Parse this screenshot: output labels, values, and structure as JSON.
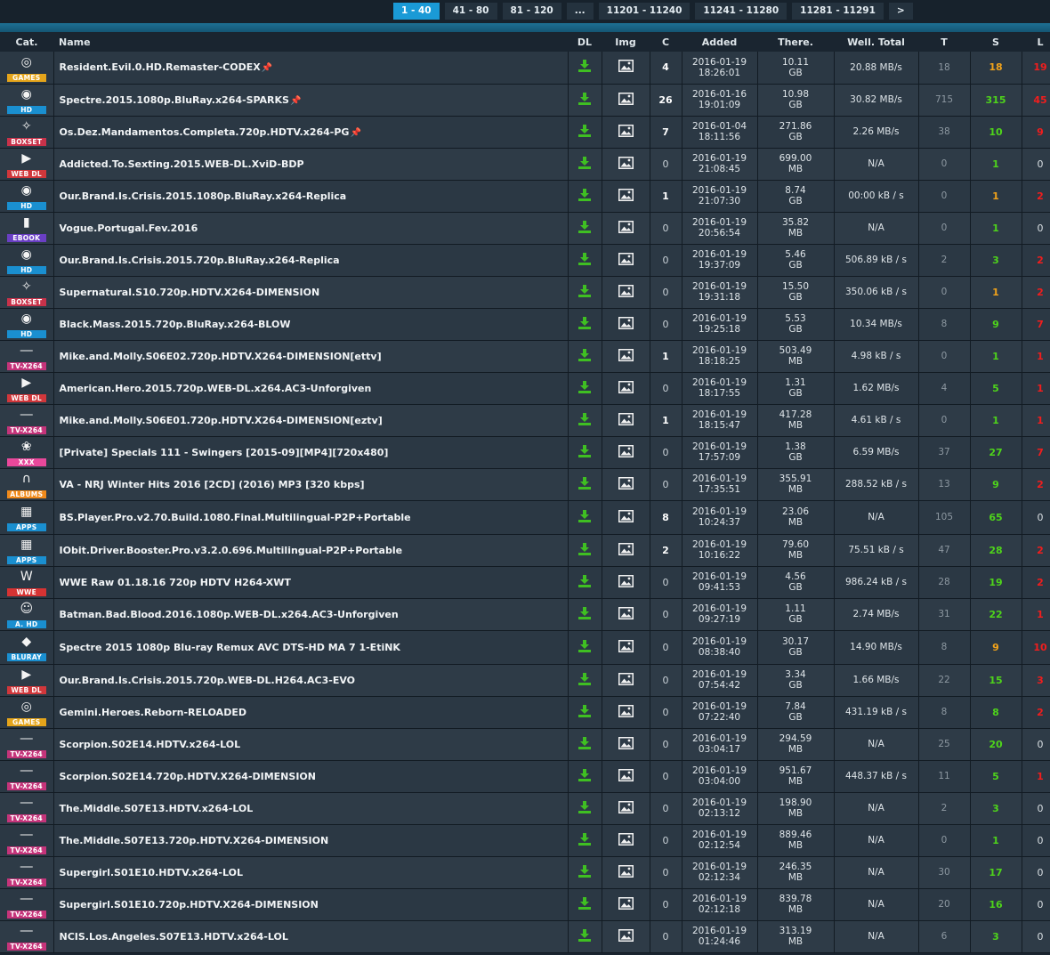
{
  "pagination": {
    "pages": [
      "1 - 40",
      "41 - 80",
      "81 - 120",
      "...",
      "11201 - 11240",
      "11241 - 11280",
      "11281 - 11291",
      ">"
    ],
    "active": 0
  },
  "headers": {
    "cat": "Cat.",
    "name": "Name",
    "dl": "DL",
    "img": "Img",
    "c": "C",
    "added": "Added",
    "size": "There.",
    "speed": "Well. Total",
    "t": "T",
    "s": "S",
    "l": "L"
  },
  "categories": {
    "GAMES": {
      "color": "#e5a51b",
      "icon": "disc-icon",
      "glyph": "◎"
    },
    "HD": {
      "color": "#1a8fd0",
      "icon": "disc-icon",
      "glyph": "◉"
    },
    "BOXSET": {
      "color": "#c8324a",
      "icon": "box-icon",
      "glyph": "✧"
    },
    "WEB DL": {
      "color": "#d1373b",
      "icon": "play-icon",
      "glyph": "▶"
    },
    "EBOOK": {
      "color": "#6a3fc4",
      "icon": "book-icon",
      "glyph": "▮"
    },
    "TV-X264": {
      "color": "#c5347a",
      "icon": "tv-icon",
      "glyph": "―"
    },
    "XXX": {
      "color": "#e9489b",
      "icon": "bunny-icon",
      "glyph": "❀"
    },
    "ALBUMS": {
      "color": "#f08a1b",
      "icon": "headphones-icon",
      "glyph": "∩"
    },
    "APPS": {
      "color": "#1a8fd0",
      "icon": "windows-icon",
      "glyph": "▦"
    },
    "WWE": {
      "color": "#d63333",
      "icon": "wwe-icon",
      "glyph": "W"
    },
    "A. HD": {
      "color": "#1a8fd0",
      "icon": "cartoon-icon",
      "glyph": "☺"
    },
    "BLURAY": {
      "color": "#1a8fd0",
      "icon": "bluray-icon",
      "glyph": "◆"
    }
  },
  "rows": [
    {
      "cat": "GAMES",
      "name": "Resident.Evil.0.HD.Remaster-CODEX",
      "pinned": true,
      "c": "4",
      "added": [
        "2016-01-19",
        "18:26:01"
      ],
      "size": [
        "10.11",
        "GB"
      ],
      "speed": "20.88 MB/s",
      "t": "18",
      "s": "18",
      "l": "19",
      "s_orange": true
    },
    {
      "cat": "HD",
      "name": "Spectre.2015.1080p.BluRay.x264-SPARKS",
      "pinned": true,
      "c": "26",
      "added": [
        "2016-01-16",
        "19:01:09"
      ],
      "size": [
        "10.98",
        "GB"
      ],
      "speed": "30.82 MB/s",
      "t": "715",
      "s": "315",
      "l": "45"
    },
    {
      "cat": "BOXSET",
      "name": "Os.Dez.Mandamentos.Completa.720p.HDTV.x264-PG",
      "pinned": true,
      "c": "7",
      "added": [
        "2016-01-04",
        "18:11:56"
      ],
      "size": [
        "271.86",
        "GB"
      ],
      "speed": "2.26 MB/s",
      "t": "38",
      "s": "10",
      "l": "9"
    },
    {
      "cat": "WEB DL",
      "name": "Addicted.To.Sexting.2015.WEB-DL.XviD-BDP",
      "pinned": false,
      "c": "0",
      "added": [
        "2016-01-19",
        "21:08:45"
      ],
      "size": [
        "699.00",
        "MB"
      ],
      "speed": "N/A",
      "t": "0",
      "s": "1",
      "l": "0"
    },
    {
      "cat": "HD",
      "name": "Our.Brand.Is.Crisis.2015.1080p.BluRay.x264-Replica",
      "pinned": false,
      "c": "1",
      "added": [
        "2016-01-19",
        "21:07:30"
      ],
      "size": [
        "8.74",
        "GB"
      ],
      "speed": "00:00 kB / s",
      "t": "0",
      "s": "1",
      "l": "2",
      "s_orange": true
    },
    {
      "cat": "EBOOK",
      "name": "Vogue.Portugal.Fev.2016",
      "pinned": false,
      "c": "0",
      "added": [
        "2016-01-19",
        "20:56:54"
      ],
      "size": [
        "35.82",
        "MB"
      ],
      "speed": "N/A",
      "t": "0",
      "s": "1",
      "l": "0"
    },
    {
      "cat": "HD",
      "name": "Our.Brand.Is.Crisis.2015.720p.BluRay.x264-Replica",
      "pinned": false,
      "c": "0",
      "added": [
        "2016-01-19",
        "19:37:09"
      ],
      "size": [
        "5.46",
        "GB"
      ],
      "speed": "506.89 kB / s",
      "t": "2",
      "s": "3",
      "l": "2"
    },
    {
      "cat": "BOXSET",
      "name": "Supernatural.S10.720p.HDTV.X264-DIMENSION",
      "pinned": false,
      "c": "0",
      "added": [
        "2016-01-19",
        "19:31:18"
      ],
      "size": [
        "15.50",
        "GB"
      ],
      "speed": "350.06 kB / s",
      "t": "0",
      "s": "1",
      "l": "2",
      "s_orange": true
    },
    {
      "cat": "HD",
      "name": "Black.Mass.2015.720p.BluRay.x264-BLOW",
      "pinned": false,
      "c": "0",
      "added": [
        "2016-01-19",
        "19:25:18"
      ],
      "size": [
        "5.53",
        "GB"
      ],
      "speed": "10.34 MB/s",
      "t": "8",
      "s": "9",
      "l": "7"
    },
    {
      "cat": "TV-X264",
      "name": "Mike.and.Molly.S06E02.720p.HDTV.X264-DIMENSION[ettv]",
      "pinned": false,
      "c": "1",
      "added": [
        "2016-01-19",
        "18:18:25"
      ],
      "size": [
        "503.49",
        "MB"
      ],
      "speed": "4.98 kB / s",
      "t": "0",
      "s": "1",
      "l": "1"
    },
    {
      "cat": "WEB DL",
      "name": "American.Hero.2015.720p.WEB-DL.x264.AC3-Unforgiven",
      "pinned": false,
      "c": "0",
      "added": [
        "2016-01-19",
        "18:17:55"
      ],
      "size": [
        "1.31",
        "GB"
      ],
      "speed": "1.62 MB/s",
      "t": "4",
      "s": "5",
      "l": "1"
    },
    {
      "cat": "TV-X264",
      "name": "Mike.and.Molly.S06E01.720p.HDTV.X264-DIMENSION[eztv]",
      "pinned": false,
      "c": "1",
      "added": [
        "2016-01-19",
        "18:15:47"
      ],
      "size": [
        "417.28",
        "MB"
      ],
      "speed": "4.61 kB / s",
      "t": "0",
      "s": "1",
      "l": "1"
    },
    {
      "cat": "XXX",
      "name": "[Private] Specials 111 - Swingers [2015-09][MP4][720x480]",
      "pinned": false,
      "c": "0",
      "added": [
        "2016-01-19",
        "17:57:09"
      ],
      "size": [
        "1.38",
        "GB"
      ],
      "speed": "6.59 MB/s",
      "t": "37",
      "s": "27",
      "l": "7"
    },
    {
      "cat": "ALBUMS",
      "name": "VA - NRJ Winter Hits 2016 [2CD] (2016) MP3 [320 kbps]",
      "pinned": false,
      "c": "0",
      "added": [
        "2016-01-19",
        "17:35:51"
      ],
      "size": [
        "355.91",
        "MB"
      ],
      "speed": "288.52 kB / s",
      "t": "13",
      "s": "9",
      "l": "2"
    },
    {
      "cat": "APPS",
      "name": "BS.Player.Pro.v2.70.Build.1080.Final.Multilingual-P2P+Portable",
      "pinned": false,
      "c": "8",
      "added": [
        "2016-01-19",
        "10:24:37"
      ],
      "size": [
        "23.06",
        "MB"
      ],
      "speed": "N/A",
      "t": "105",
      "s": "65",
      "l": "0",
      "tall": true
    },
    {
      "cat": "APPS",
      "name": "IObit.Driver.Booster.Pro.v3.2.0.696.Multilingual-P2P+Portable",
      "pinned": false,
      "c": "2",
      "added": [
        "2016-01-19",
        "10:16:22"
      ],
      "size": [
        "79.60",
        "MB"
      ],
      "speed": "75.51 kB / s",
      "t": "47",
      "s": "28",
      "l": "2"
    },
    {
      "cat": "WWE",
      "name": "WWE Raw 01.18.16 720p HDTV H264-XWT",
      "pinned": false,
      "c": "0",
      "added": [
        "2016-01-19",
        "09:41:53"
      ],
      "size": [
        "4.56",
        "GB"
      ],
      "speed": "986.24 kB / s",
      "t": "28",
      "s": "19",
      "l": "2"
    },
    {
      "cat": "A. HD",
      "name": "Batman.Bad.Blood.2016.1080p.WEB-DL.x264.AC3-Unforgiven",
      "pinned": false,
      "c": "0",
      "added": [
        "2016-01-19",
        "09:27:19"
      ],
      "size": [
        "1.11",
        "GB"
      ],
      "speed": "2.74 MB/s",
      "t": "31",
      "s": "22",
      "l": "1"
    },
    {
      "cat": "BLURAY",
      "name": "Spectre 2015 1080p Blu-ray Remux AVC DTS-HD MA 7 1-EtiNK",
      "pinned": false,
      "c": "0",
      "added": [
        "2016-01-19",
        "08:38:40"
      ],
      "size": [
        "30.17",
        "GB"
      ],
      "speed": "14.90 MB/s",
      "t": "8",
      "s": "9",
      "l": "10",
      "s_orange": true,
      "tall": true
    },
    {
      "cat": "WEB DL",
      "name": "Our.Brand.Is.Crisis.2015.720p.WEB-DL.H264.AC3-EVO",
      "pinned": false,
      "c": "0",
      "added": [
        "2016-01-19",
        "07:54:42"
      ],
      "size": [
        "3.34",
        "GB"
      ],
      "speed": "1.66 MB/s",
      "t": "22",
      "s": "15",
      "l": "3"
    },
    {
      "cat": "GAMES",
      "name": "Gemini.Heroes.Reborn-RELOADED",
      "pinned": false,
      "c": "0",
      "added": [
        "2016-01-19",
        "07:22:40"
      ],
      "size": [
        "7.84",
        "GB"
      ],
      "speed": "431.19 kB / s",
      "t": "8",
      "s": "8",
      "l": "2"
    },
    {
      "cat": "TV-X264",
      "name": "Scorpion.S02E14.HDTV.x264-LOL",
      "pinned": false,
      "c": "0",
      "added": [
        "2016-01-19",
        "03:04:17"
      ],
      "size": [
        "294.59",
        "MB"
      ],
      "speed": "N/A",
      "t": "25",
      "s": "20",
      "l": "0"
    },
    {
      "cat": "TV-X264",
      "name": "Scorpion.S02E14.720p.HDTV.X264-DIMENSION",
      "pinned": false,
      "c": "0",
      "added": [
        "2016-01-19",
        "03:04:00"
      ],
      "size": [
        "951.67",
        "MB"
      ],
      "speed": "448.37 kB / s",
      "t": "11",
      "s": "5",
      "l": "1"
    },
    {
      "cat": "TV-X264",
      "name": "The.Middle.S07E13.HDTV.x264-LOL",
      "pinned": false,
      "c": "0",
      "added": [
        "2016-01-19",
        "02:13:12"
      ],
      "size": [
        "198.90",
        "MB"
      ],
      "speed": "N/A",
      "t": "2",
      "s": "3",
      "l": "0"
    },
    {
      "cat": "TV-X264",
      "name": "The.Middle.S07E13.720p.HDTV.X264-DIMENSION",
      "pinned": false,
      "c": "0",
      "added": [
        "2016-01-19",
        "02:12:54"
      ],
      "size": [
        "889.46",
        "MB"
      ],
      "speed": "N/A",
      "t": "0",
      "s": "1",
      "l": "0"
    },
    {
      "cat": "TV-X264",
      "name": "Supergirl.S01E10.HDTV.x264-LOL",
      "pinned": false,
      "c": "0",
      "added": [
        "2016-01-19",
        "02:12:34"
      ],
      "size": [
        "246.35",
        "MB"
      ],
      "speed": "N/A",
      "t": "30",
      "s": "17",
      "l": "0"
    },
    {
      "cat": "TV-X264",
      "name": "Supergirl.S01E10.720p.HDTV.X264-DIMENSION",
      "pinned": false,
      "c": "0",
      "added": [
        "2016-01-19",
        "02:12:18"
      ],
      "size": [
        "839.78",
        "MB"
      ],
      "speed": "N/A",
      "t": "20",
      "s": "16",
      "l": "0"
    },
    {
      "cat": "TV-X264",
      "name": "NCIS.Los.Angeles.S07E13.HDTV.x264-LOL",
      "pinned": false,
      "c": "0",
      "added": [
        "2016-01-19",
        "01:24:46"
      ],
      "size": [
        "313.19",
        "MB"
      ],
      "speed": "N/A",
      "t": "6",
      "s": "3",
      "l": "0"
    }
  ]
}
